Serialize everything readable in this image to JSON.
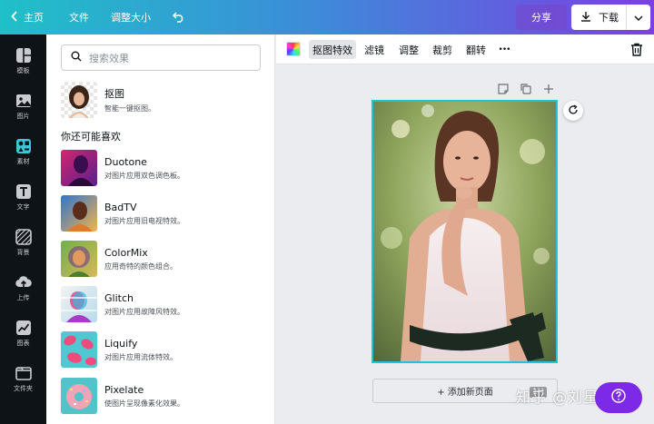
{
  "topbar": {
    "home_label": "主页",
    "file_label": "文件",
    "resize_label": "调整大小",
    "share_label": "分享",
    "download_label": "下载",
    "gradient": [
      "#20c0c8",
      "#7b3fe4"
    ]
  },
  "rail": {
    "items": [
      {
        "label": "模板",
        "icon": "template-icon"
      },
      {
        "label": "图片",
        "icon": "image-icon"
      },
      {
        "label": "素材",
        "icon": "elements-icon",
        "active": true
      },
      {
        "label": "文字",
        "icon": "text-icon"
      },
      {
        "label": "背景",
        "icon": "background-icon"
      },
      {
        "label": "上传",
        "icon": "upload-icon"
      },
      {
        "label": "图表",
        "icon": "chart-icon"
      },
      {
        "label": "文件夹",
        "icon": "folder-icon"
      }
    ]
  },
  "panel": {
    "search_placeholder": "搜索效果",
    "cutout": {
      "title": "抠图",
      "desc": "智能一键抠图。"
    },
    "section_title": "你还可能喜欢",
    "effects": [
      {
        "title": "Duotone",
        "desc": "对图片应用双色调色板。"
      },
      {
        "title": "BadTV",
        "desc": "对图片应用旧电视特效。"
      },
      {
        "title": "ColorMix",
        "desc": "应用奇特的颜色组合。"
      },
      {
        "title": "Glitch",
        "desc": "对图片应用故障风特效。"
      },
      {
        "title": "Liquify",
        "desc": "对图片应用流体特效。"
      },
      {
        "title": "Pixelate",
        "desc": "使图片呈现像素化效果。"
      }
    ]
  },
  "toolbar": {
    "tools": [
      "抠图特效",
      "滤镜",
      "调整",
      "裁剪",
      "翻转"
    ],
    "more": "•••",
    "active_tool": "抠图特效"
  },
  "canvas": {
    "add_page_label": "+ 添加新页面",
    "zoom_chip": "1H",
    "selection_color": "#22c3d3"
  },
  "watermark": "知乎 @刘星文"
}
